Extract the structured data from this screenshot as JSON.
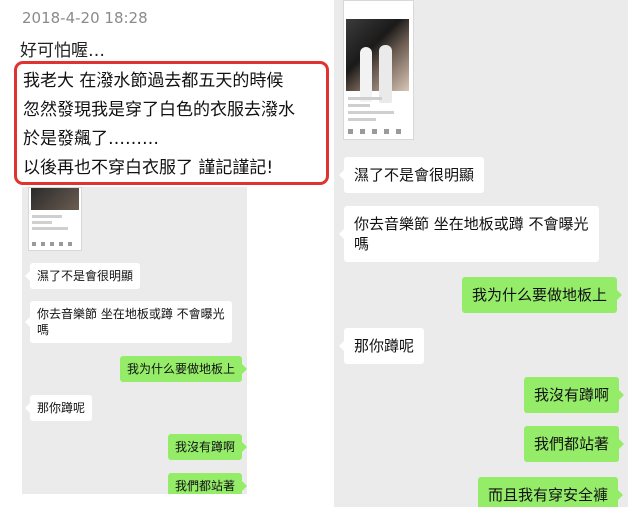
{
  "post": {
    "timestamp": "2018-4-20 18:28",
    "lines": [
      "好可怕喔…",
      "我老大 在潑水節過去都五天的時候",
      "忽然發現我是穿了白色的衣服去潑水",
      "於是發飆了………",
      "以後再也不穿白衣服了 謹記謹記!"
    ]
  },
  "left_chat": {
    "messages": [
      {
        "side": "in",
        "text": "濕了不是會很明顯"
      },
      {
        "side": "in",
        "line1": "你去音樂節 坐在地板或蹲 不會曝光",
        "line2": "嗎"
      },
      {
        "side": "out",
        "text": "我为什么要做地板上"
      },
      {
        "side": "in",
        "text": "那你蹲呢"
      },
      {
        "side": "out",
        "text": "我沒有蹲啊"
      },
      {
        "side": "out",
        "text": "我們都站著"
      }
    ]
  },
  "right_chat": {
    "messages": [
      {
        "side": "in",
        "text": "濕了不是會很明顯"
      },
      {
        "side": "in",
        "line1": "你去音樂節 坐在地板或蹲 不會曝光",
        "line2": "嗎"
      },
      {
        "side": "out",
        "text": "我为什么要做地板上"
      },
      {
        "side": "in",
        "text": "那你蹲呢"
      },
      {
        "side": "out",
        "text": "我沒有蹲啊"
      },
      {
        "side": "out",
        "text": "我們都站著"
      },
      {
        "side": "out",
        "text": "而且我有穿安全褲"
      }
    ]
  },
  "colors": {
    "highlight_border": "#e0322f",
    "outgoing_bubble": "#95ec69",
    "chat_background": "#ebebeb"
  }
}
